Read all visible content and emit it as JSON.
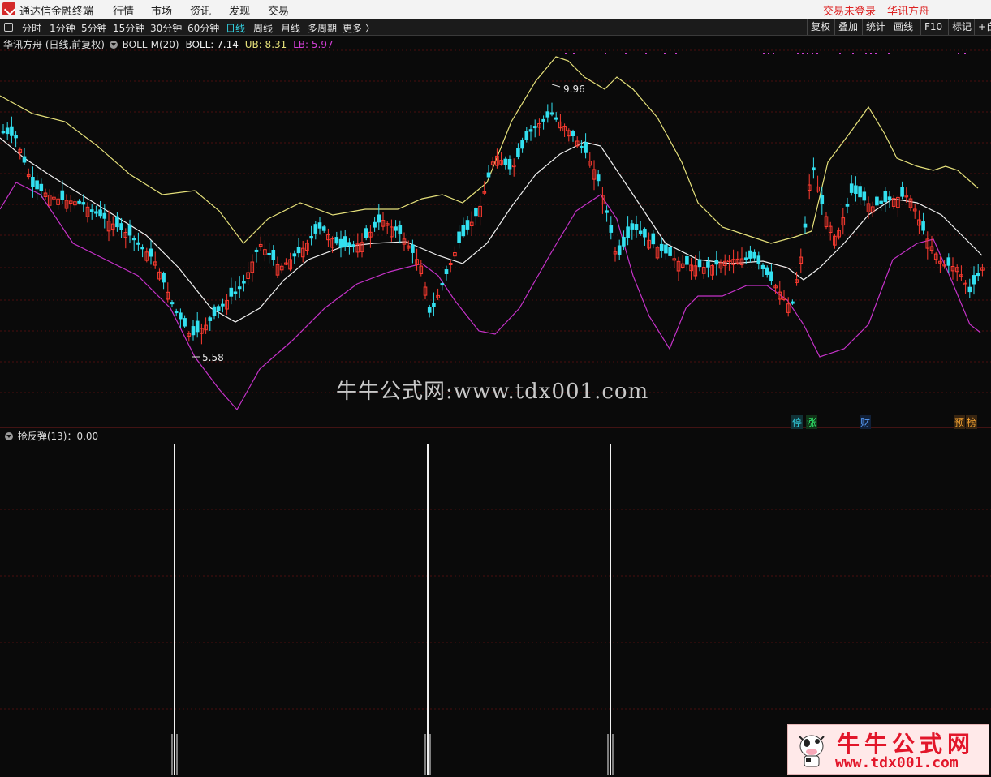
{
  "menubar": {
    "app_title": "通达信金融终端",
    "menus": [
      "行情",
      "市场",
      "资讯",
      "发现",
      "交易"
    ],
    "login_status": "交易未登录",
    "stock_name": "华讯方舟"
  },
  "toolbar": {
    "periods": [
      "分时",
      "1分钟",
      "5分钟",
      "15分钟",
      "30分钟",
      "60分钟",
      "日线",
      "周线",
      "月线",
      "多周期",
      "更多 〉"
    ],
    "active_period": "日线",
    "right_buttons": [
      "复权",
      "叠加",
      "统计",
      "画线",
      "F10",
      "标记",
      "+自"
    ]
  },
  "main_chart": {
    "stock_label": "华讯方舟 (日线,前复权)",
    "indicator_name": "BOLL-M(20)",
    "boll_label": "BOLL: 7.14",
    "ub_label": "UB: 8.31",
    "lb_label": "LB: 5.97",
    "high_marker": "9.96",
    "low_marker": "5.58",
    "colors": {
      "up": "#ff3b30",
      "down": "#33e0f0",
      "mid": "#f0f0f0",
      "upper": "#e5e07a",
      "lower": "#c532c8",
      "grid": "#4a0f0f"
    },
    "badges": [
      "停",
      "涨",
      "财",
      "预",
      "榜"
    ]
  },
  "sub_chart": {
    "indicator_label": "抢反弹(13)：0.00"
  },
  "watermark": "牛牛公式网:www.tdx001.com",
  "logo": {
    "line1": "牛牛公式网",
    "line2": "www.tdx001.com"
  }
}
